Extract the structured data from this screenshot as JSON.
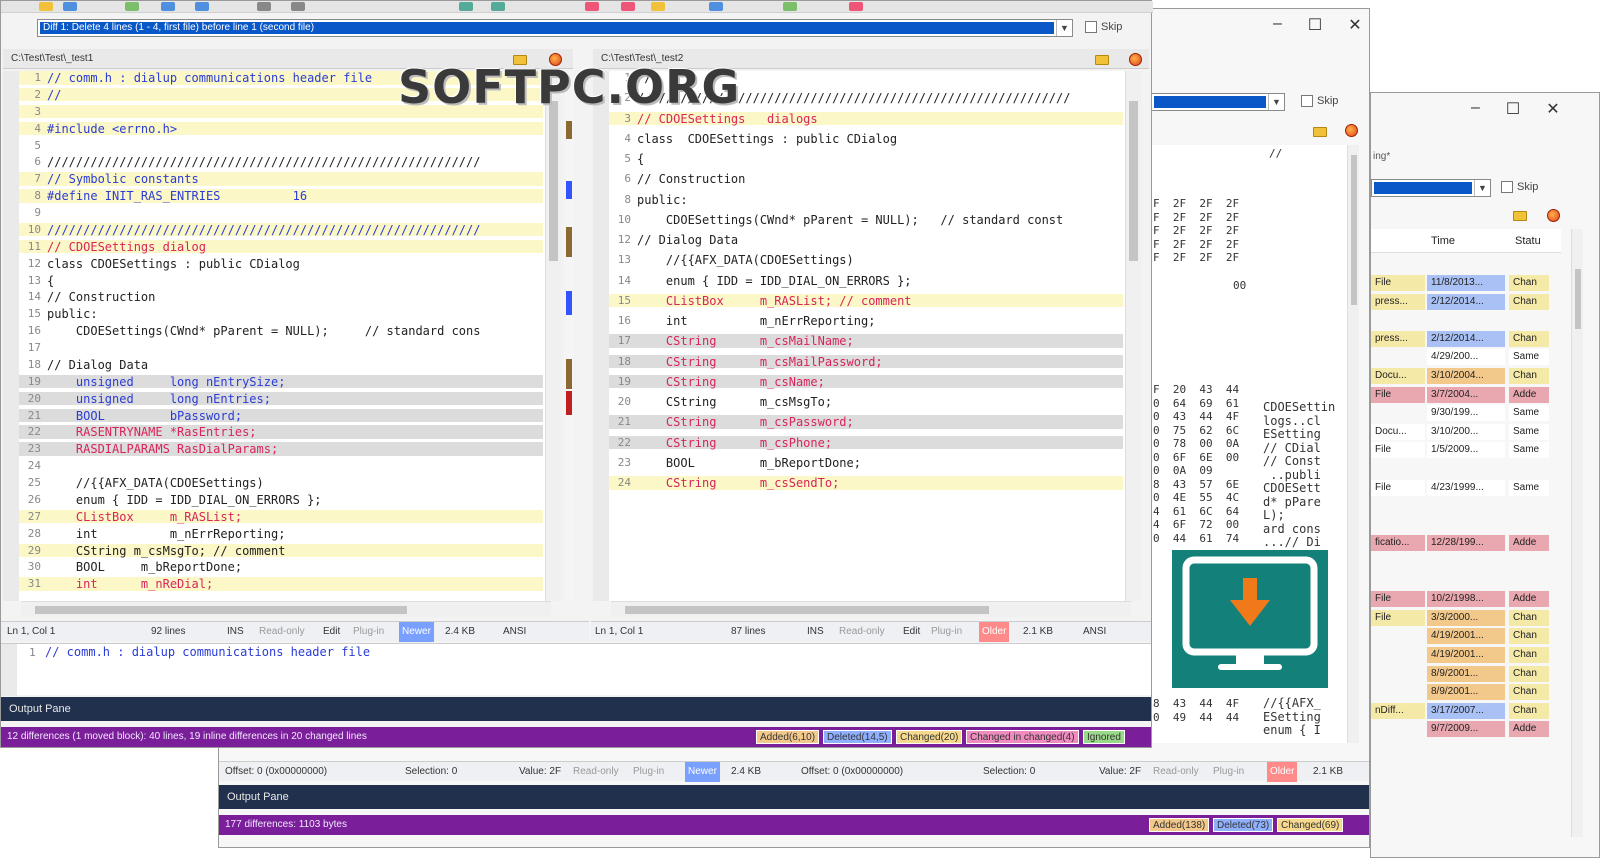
{
  "window_main": {
    "combo_text": "Diff 1: Delete 4 lines (1 - 4, first file) before line 1 (second file)",
    "skip_label": "Skip",
    "left": {
      "path": "C:\\Test\\Test\\_test1",
      "lines": [
        {
          "n": "1",
          "t": "// comm.h : dialup communications header file",
          "cls": "t-blue bg-y"
        },
        {
          "n": "2",
          "t": "//",
          "cls": "t-blue bg-y"
        },
        {
          "n": "3",
          "t": "",
          "cls": "bg-y"
        },
        {
          "n": "4",
          "t": "#include <errno.h>",
          "cls": "t-blue bg-y"
        },
        {
          "n": "5",
          "t": "",
          "cls": ""
        },
        {
          "n": "6",
          "t": "////////////////////////////////////////////////////////////",
          "cls": ""
        },
        {
          "n": "7",
          "t": "// Symbolic constants",
          "cls": "t-blue bg-y"
        },
        {
          "n": "8",
          "t": "#define INIT_RAS_ENTRIES          16",
          "cls": "t-blue bg-y"
        },
        {
          "n": "9",
          "t": "",
          "cls": ""
        },
        {
          "n": "10",
          "t": "////////////////////////////////////////////////////////////",
          "cls": "t-blue bg-y"
        },
        {
          "n": "11",
          "t": "// CDOESettings dialog",
          "cls": "t-pink bg-y"
        },
        {
          "n": "12",
          "t": "class CDOESettings : public CDialog",
          "cls": ""
        },
        {
          "n": "13",
          "t": "{",
          "cls": ""
        },
        {
          "n": "14",
          "t": "// Construction",
          "cls": ""
        },
        {
          "n": "15",
          "t": "public:",
          "cls": ""
        },
        {
          "n": "16",
          "t": "    CDOESettings(CWnd* pParent = NULL);     // standard cons",
          "cls": ""
        },
        {
          "n": "17",
          "t": "",
          "cls": ""
        },
        {
          "n": "18",
          "t": "// Dialog Data",
          "cls": ""
        },
        {
          "n": "19",
          "t": "    unsigned     long nEntrySize;",
          "cls": "t-blue bg-g"
        },
        {
          "n": "20",
          "t": "    unsigned     long nEntries;",
          "cls": "t-blue bg-g"
        },
        {
          "n": "21",
          "t": "    BOOL         bPassword;",
          "cls": "t-blue bg-g"
        },
        {
          "n": "22",
          "t": "    RASENTRYNAME *RasEntries;",
          "cls": "t-red bg-g"
        },
        {
          "n": "23",
          "t": "    RASDIALPARAMS RasDialParams;",
          "cls": "t-red bg-g"
        },
        {
          "n": "24",
          "t": "",
          "cls": ""
        },
        {
          "n": "25",
          "t": "    //{{AFX_DATA(CDOESettings)",
          "cls": ""
        },
        {
          "n": "26",
          "t": "    enum { IDD = IDD_DIAL_ON_ERRORS };",
          "cls": ""
        },
        {
          "n": "27",
          "t": "    CListBox     m_RASList;",
          "cls": "t-pink bg-y"
        },
        {
          "n": "28",
          "t": "    int          m_nErrReporting;",
          "cls": ""
        },
        {
          "n": "29",
          "t": "    CString m_csMsgTo; // comment",
          "cls": "bg-y"
        },
        {
          "n": "30",
          "t": "    BOOL     m_bReportDone;",
          "cls": ""
        },
        {
          "n": "31",
          "t": "    int      m_nReDial;",
          "cls": "t-pink bg-y"
        }
      ],
      "status": {
        "pos": "Ln 1, Col 1",
        "lines": "92 lines",
        "ins": "INS",
        "ro": "Read-only",
        "edit": "Edit",
        "plugin": "Plug-in",
        "age": "Newer",
        "size": "2.4 KB",
        "enc": "ANSI"
      }
    },
    "right": {
      "path": "C:\\Test\\Test\\_test2",
      "lines": [
        {
          "n": "1",
          "t": "//",
          "cls": ""
        },
        {
          "n": "2",
          "t": "////////////////////////////////////////////////////////////",
          "cls": ""
        },
        {
          "n": "3",
          "t": "// CDOESettings   dialogs",
          "cls": "t-pink bg-y"
        },
        {
          "n": "4",
          "t": "class  CDOESettings : public CDialog",
          "cls": ""
        },
        {
          "n": "5",
          "t": "{",
          "cls": ""
        },
        {
          "n": "6",
          "t": "// Construction",
          "cls": ""
        },
        {
          "n": "8",
          "t": "public:",
          "cls": ""
        },
        {
          "n": "10",
          "t": "    CDOESettings(CWnd* pParent = NULL);   // standard const",
          "cls": ""
        },
        {
          "n": "12",
          "t": "// Dialog Data",
          "cls": ""
        },
        {
          "n": "13",
          "t": "    //{{AFX_DATA(CDOESettings)",
          "cls": ""
        },
        {
          "n": "14",
          "t": "    enum { IDD = IDD_DIAL_ON_ERRORS };",
          "cls": ""
        },
        {
          "n": "15",
          "t": "    CListBox     m_RASList; // comment",
          "cls": "t-pink bg-y"
        },
        {
          "n": "16",
          "t": "    int          m_nErrReporting;",
          "cls": ""
        },
        {
          "n": "17",
          "t": "    CString      m_csMailName;",
          "cls": "t-pink bg-g"
        },
        {
          "n": "18",
          "t": "    CString      m_csMailPassword;",
          "cls": "t-pink bg-g"
        },
        {
          "n": "19",
          "t": "    CString      m_csName;",
          "cls": "t-pink bg-g"
        },
        {
          "n": "20",
          "t": "    CString      m_csMsgTo;",
          "cls": ""
        },
        {
          "n": "21",
          "t": "    CString      m_csPassword;",
          "cls": "t-pink bg-g"
        },
        {
          "n": "22",
          "t": "    CString      m_csPhone;",
          "cls": "t-pink bg-g"
        },
        {
          "n": "23",
          "t": "    BOOL         m_bReportDone;",
          "cls": ""
        },
        {
          "n": "24",
          "t": "    CString      m_csSendTo;",
          "cls": "t-pink bg-y"
        }
      ],
      "status": {
        "pos": "Ln 1, Col 1",
        "lines": "87 lines",
        "ins": "INS",
        "ro": "Read-only",
        "edit": "Edit",
        "plugin": "Plug-in",
        "age": "Older",
        "size": "2.1 KB",
        "enc": "ANSI"
      }
    },
    "detail_line": "// comm.h : dialup communications header file",
    "output_pane_title": "Output Pane",
    "summary": "12 differences (1 moved block): 40 lines, 19 inline differences in 20 changed lines",
    "legend": [
      {
        "label": "Added(6,10)",
        "color": "#f3c98b"
      },
      {
        "label": "Deleted(14,5)",
        "color": "#8fb0ff"
      },
      {
        "label": "Changed(20)",
        "color": "#f7d98e"
      },
      {
        "label": "Changed in changed(4)",
        "color": "#f08bbf"
      },
      {
        "label": "Ignored",
        "color": "#9ad98a"
      }
    ]
  },
  "window_hex": {
    "skip_label": "Skip",
    "hex_rows": "F  2F  2F  2F\nF  2F  2F  2F\nF  2F  2F  2F\nF  2F  2F  2F\nF  2F  2F  2F",
    "hex_00": "00",
    "hex_rows2": "F  20  43  44\n0  64  69  61\n0  43  44  4F\n0  75  62  6C\n0  78  00  0A\n0  6F  6E  00\n0  0A  09\n8  43  57  6E\n0  4E  55  4C\n4  61  6C  64\n4  6F  72  00\n0  44  61  74",
    "ascii_rows": "CDOESettin\nlogs..cl\nESetting\n// CDial\n// Const\n ..publi\nCDOESett\nd* pPare\nL);\nard cons\n...// Di",
    "ascii_top": "//",
    "hex_bottom": "8  43  44  4F\n0  49  44  44",
    "ascii_bottom": "//{{AFX_\nESetting\nenum { I",
    "status_left": {
      "offset": "Offset: 0 (0x00000000)",
      "sel": "Selection: 0",
      "value": "Value: 2F",
      "ro": "Read-only",
      "plugin": "Plug-in",
      "age": "Newer",
      "size": "2.4 KB"
    },
    "status_right": {
      "offset": "Offset: 0 (0x00000000)",
      "sel": "Selection: 0",
      "value": "Value: 2F",
      "ro": "Read-only",
      "plugin": "Plug-in",
      "age": "Older",
      "size": "2.1 KB"
    },
    "output_pane_title": "Output Pane",
    "summary": "177 differences: 1103 bytes",
    "legend": [
      {
        "label": "Added(138)",
        "color": "#f3c98b"
      },
      {
        "label": "Deleted(73)",
        "color": "#8fb0ff"
      },
      {
        "label": "Changed(69)",
        "color": "#f7d98e"
      }
    ]
  },
  "window_folder": {
    "skip_label": "Skip",
    "combo_label": "ing*",
    "col_time": "Time",
    "col_status": "Statu",
    "rows": [
      {
        "type": "File",
        "time": "11/8/2013...",
        "status": "Chan",
        "bg": "#f5e9a8",
        "tbg": "#a9c1f5",
        "sbg": "#f5e9a8"
      },
      {
        "type": "press...",
        "time": "2/12/2014...",
        "status": "Chan",
        "bg": "#f5e9a8",
        "tbg": "#a9c1f5",
        "sbg": "#f5e9a8"
      },
      {
        "type": "",
        "time": "",
        "status": "",
        "bg": "#ffffff",
        "tbg": "#ffffff",
        "sbg": "#ffffff"
      },
      {
        "type": "press...",
        "time": "2/12/2014...",
        "status": "Chan",
        "bg": "#f5e9a8",
        "tbg": "#a9c1f5",
        "sbg": "#f5e9a8"
      },
      {
        "type": "",
        "time": "4/29/200...",
        "status": "Same",
        "bg": "#ffffff",
        "tbg": "#ffffff",
        "sbg": "#ffffff"
      },
      {
        "type": "Docu...",
        "time": "3/10/2004...",
        "status": "Chan",
        "bg": "#f5e9a8",
        "tbg": "#f3c98b",
        "sbg": "#f5e9a8"
      },
      {
        "type": "File",
        "time": "3/7/2004...",
        "status": "Adde",
        "bg": "#e9a8b0",
        "tbg": "#e9a8b0",
        "sbg": "#e9a8b0"
      },
      {
        "type": "",
        "time": "9/30/199...",
        "status": "Same",
        "bg": "#ffffff",
        "tbg": "#ffffff",
        "sbg": "#ffffff"
      },
      {
        "type": "Docu...",
        "time": "3/10/200...",
        "status": "Same",
        "bg": "#ffffff",
        "tbg": "#ffffff",
        "sbg": "#ffffff"
      },
      {
        "type": "File",
        "time": "1/5/2009...",
        "status": "Same",
        "bg": "#ffffff",
        "tbg": "#ffffff",
        "sbg": "#ffffff"
      },
      {
        "type": "",
        "time": "",
        "status": "",
        "bg": "#ffffff",
        "tbg": "#ffffff",
        "sbg": "#ffffff"
      },
      {
        "type": "File",
        "time": "4/23/1999...",
        "status": "Same",
        "bg": "#ffffff",
        "tbg": "#ffffff",
        "sbg": "#ffffff"
      },
      {
        "type": "",
        "time": "",
        "status": "",
        "bg": "#ffffff",
        "tbg": "#ffffff",
        "sbg": "#ffffff"
      },
      {
        "type": "",
        "time": "",
        "status": "",
        "bg": "#ffffff",
        "tbg": "#ffffff",
        "sbg": "#ffffff"
      },
      {
        "type": "ficatio...",
        "time": "12/28/199...",
        "status": "Adde",
        "bg": "#e9a8b0",
        "tbg": "#e9a8b0",
        "sbg": "#e9a8b0"
      },
      {
        "type": "",
        "time": "",
        "status": "",
        "bg": "#ffffff",
        "tbg": "#ffffff",
        "sbg": "#ffffff"
      },
      {
        "type": "",
        "time": "",
        "status": "",
        "bg": "#ffffff",
        "tbg": "#ffffff",
        "sbg": "#ffffff"
      },
      {
        "type": "File",
        "time": "10/2/1998...",
        "status": "Adde",
        "bg": "#e9a8b0",
        "tbg": "#e9a8b0",
        "sbg": "#e9a8b0"
      },
      {
        "type": "File",
        "time": "3/3/2000...",
        "status": "Chan",
        "bg": "#f5e9a8",
        "tbg": "#f3c98b",
        "sbg": "#f5e9a8"
      },
      {
        "type": "",
        "time": "4/19/2001...",
        "status": "Chan",
        "bg": "#f5e9a8",
        "tbg": "#f3c98b",
        "sbg": "#f5e9a8"
      },
      {
        "type": "",
        "time": "4/19/2001...",
        "status": "Chan",
        "bg": "#f5e9a8",
        "tbg": "#f3c98b",
        "sbg": "#f5e9a8"
      },
      {
        "type": "",
        "time": "8/9/2001...",
        "status": "Chan",
        "bg": "#f5e9a8",
        "tbg": "#f3c98b",
        "sbg": "#f5e9a8"
      },
      {
        "type": "",
        "time": "8/9/2001...",
        "status": "Chan",
        "bg": "#f5e9a8",
        "tbg": "#f3c98b",
        "sbg": "#f5e9a8"
      },
      {
        "type": "nDiff...",
        "time": "3/17/2007...",
        "status": "Chan",
        "bg": "#f5e9a8",
        "tbg": "#a9c1f5",
        "sbg": "#f5e9a8"
      },
      {
        "type": "",
        "time": "9/7/2009...",
        "status": "Adde",
        "bg": "#e9a8b0",
        "tbg": "#e9a8b0",
        "sbg": "#e9a8b0"
      }
    ]
  },
  "watermark": "SOFTPC.ORG"
}
